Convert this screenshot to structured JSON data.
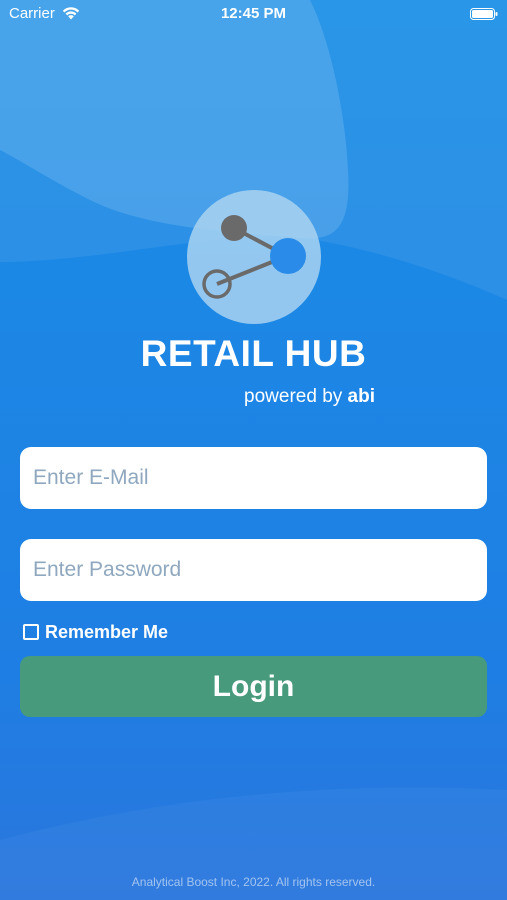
{
  "status_bar": {
    "carrier": "Carrier",
    "time": "12:45 PM",
    "icons": [
      "wifi-icon",
      "battery-icon"
    ]
  },
  "brand": {
    "title": "RETAIL HUB",
    "powered_prefix": "powered by",
    "powered_name": "abi",
    "logo_icon": "share-nodes-icon"
  },
  "form": {
    "email_placeholder": "Enter E-Mail",
    "email_value": "",
    "password_placeholder": "Enter Password",
    "password_value": "",
    "remember_label": "Remember Me",
    "remember_checked": false,
    "login_label": "Login"
  },
  "footer": {
    "text": "Analytical Boost Inc, 2022. All rights reserved."
  },
  "colors": {
    "background": "#1d86e5",
    "login_button": "#489a7c",
    "logo_circle": "#add5f2",
    "node_blue": "#2a8ce8",
    "node_gray": "#6a6a6a"
  }
}
